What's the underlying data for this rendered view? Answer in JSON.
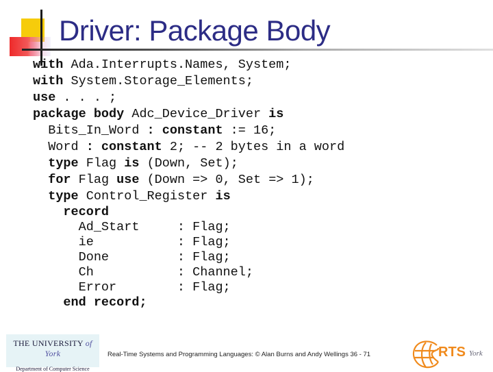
{
  "slide": {
    "title": "Driver: Package Body",
    "code_lines": [
      [
        {
          "t": "with",
          "k": 1
        },
        {
          "t": " Ada.Interrupts.Names, System;"
        }
      ],
      [
        {
          "t": "with",
          "k": 1
        },
        {
          "t": " System.Storage_Elements;"
        }
      ],
      [
        {
          "t": "use",
          "k": 1
        },
        {
          "t": " . . . ;"
        }
      ],
      [
        {
          "t": "package body",
          "k": 1
        },
        {
          "t": " Adc_Device_Driver "
        },
        {
          "t": "is",
          "k": 1
        }
      ],
      [
        {
          "t": "  Bits_In_Word "
        },
        {
          "t": ": constant",
          "k": 1
        },
        {
          "t": " := 16;"
        }
      ],
      [
        {
          "t": "  Word "
        },
        {
          "t": ": constant",
          "k": 1
        },
        {
          "t": " 2; -- 2 bytes in a word"
        }
      ],
      [
        {
          "t": "  "
        },
        {
          "t": "type",
          "k": 1
        },
        {
          "t": " Flag "
        },
        {
          "t": "is",
          "k": 1
        },
        {
          "t": " (Down, Set);"
        }
      ],
      [
        {
          "t": "  "
        },
        {
          "t": "for",
          "k": 1
        },
        {
          "t": " Flag "
        },
        {
          "t": "use",
          "k": 1
        },
        {
          "t": " (Down => 0, Set => 1);"
        }
      ],
      [
        {
          "t": "  "
        },
        {
          "t": "type",
          "k": 1
        },
        {
          "t": " Control_Register "
        },
        {
          "t": "is",
          "k": 1
        }
      ],
      [
        {
          "t": "    "
        },
        {
          "t": "record",
          "k": 1
        }
      ],
      [
        {
          "t": "      Ad_Start     : Flag;"
        }
      ],
      [
        {
          "t": "      ie           : Flag;"
        }
      ],
      [
        {
          "t": "      Done         : Flag;"
        }
      ],
      [
        {
          "t": "      Ch           : Channel;"
        }
      ],
      [
        {
          "t": "      Error        : Flag;"
        }
      ],
      [
        {
          "t": "    "
        },
        {
          "t": "end record;",
          "k": 1
        }
      ]
    ],
    "footer": {
      "text": "Real-Time Systems and Programming Languages: © Alan Burns and Andy Wellings 36 - 71",
      "university_logo": {
        "line1": "THE UNIVERSITY",
        "line1_italic": "of York",
        "line2": "Department of Computer Science"
      },
      "rts_logo": {
        "text": "RTS",
        "suffix": "York",
        "icon": "globe-icon"
      }
    },
    "colors": {
      "title": "#2c2c85",
      "accent_yellow": "#f6cc0b",
      "accent_red": "#ee2a2a",
      "rts_orange": "#f08a1c"
    }
  }
}
